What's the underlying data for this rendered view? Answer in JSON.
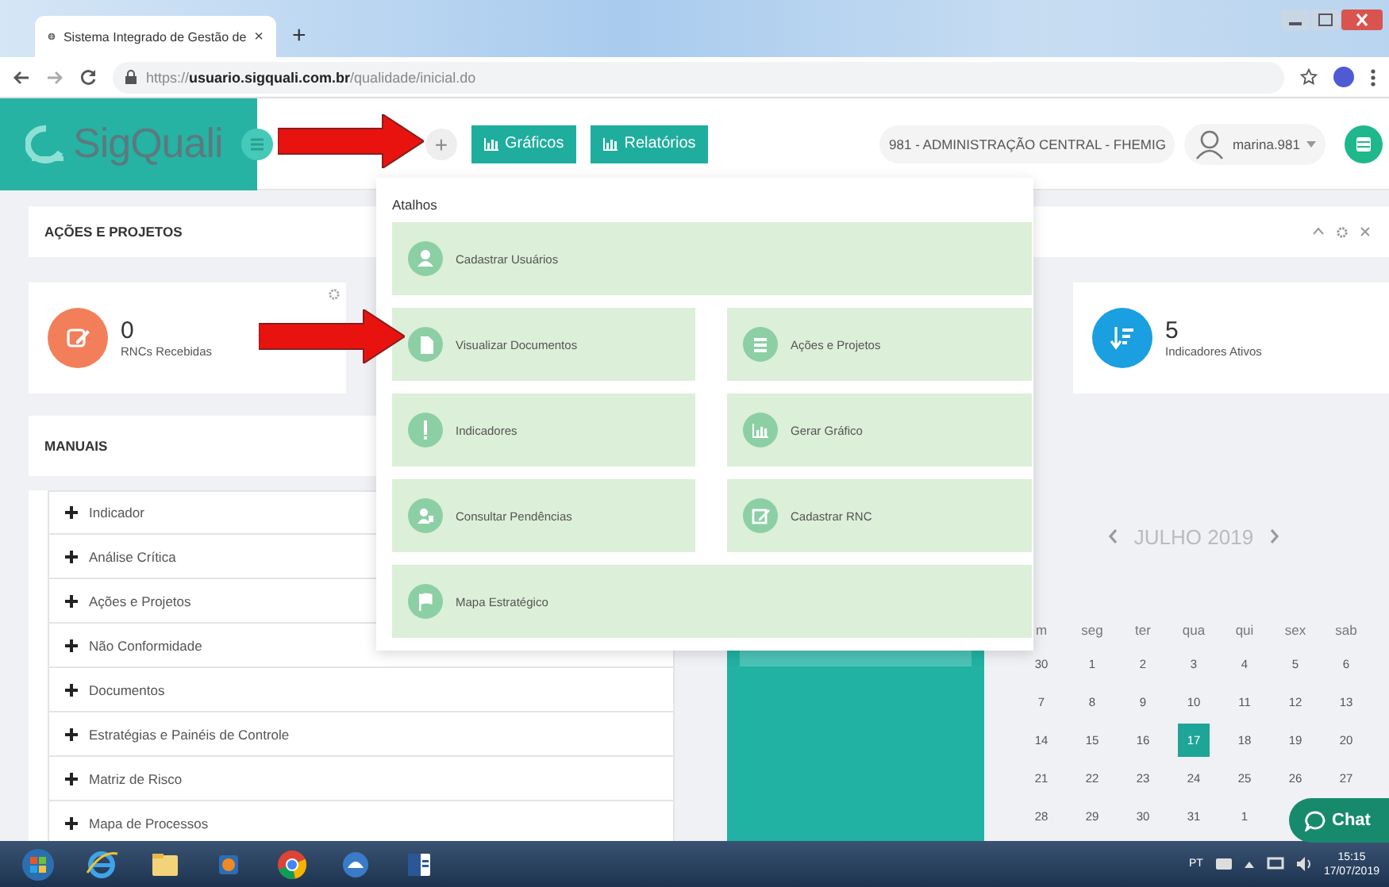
{
  "browser": {
    "tab_title": "Sistema Integrado de Gestão de",
    "tab_close": "×",
    "new_tab": "+",
    "url": "https://**usuario.sigquali.com.br**/qualidade/inicial.do"
  },
  "header": {
    "logo": "SigQuali",
    "add_button": "+",
    "buttons": [
      {
        "label": "Gráficos"
      },
      {
        "label": "Relatórios"
      }
    ],
    "unit": "981 - ADMINISTRAÇÃO CENTRAL - FHEMIG",
    "user": "marina.981"
  },
  "panel": {
    "title": "AÇÕES E PROJETOS"
  },
  "stats": [
    {
      "value": "0",
      "label": "RNCs Recebidas",
      "color": "#f27f5a",
      "kind": "edit"
    },
    {
      "value": "5",
      "label": "Indicadores Ativos",
      "color": "#1a9fe0",
      "kind": "sort"
    }
  ],
  "manuals": {
    "title": "MANUAIS",
    "items": [
      "Indicador",
      "Análise Crítica",
      "Ações e Projetos",
      "Não Conformidade",
      "Documentos",
      "Estratégias e Painéis de Controle",
      "Matriz de Risco",
      "Mapa de Processos"
    ]
  },
  "calendar": {
    "month": "JULHO 2019",
    "weekdays": [
      "m",
      "seg",
      "ter",
      "qua",
      "qui",
      "sex",
      "sab"
    ],
    "weeks": [
      [
        {
          "day": "30",
          "selected": false
        },
        {
          "day": "1",
          "selected": false
        },
        {
          "day": "2",
          "selected": false
        },
        {
          "day": "3",
          "selected": false
        },
        {
          "day": "4",
          "selected": false
        },
        {
          "day": "5",
          "selected": false
        },
        {
          "day": "6",
          "selected": false
        }
      ],
      [
        {
          "day": "7",
          "selected": false
        },
        {
          "day": "8",
          "selected": false
        },
        {
          "day": "9",
          "selected": false
        },
        {
          "day": "10",
          "selected": false
        },
        {
          "day": "11",
          "selected": false
        },
        {
          "day": "12",
          "selected": false
        },
        {
          "day": "13",
          "selected": false
        }
      ],
      [
        {
          "day": "14",
          "selected": false
        },
        {
          "day": "15",
          "selected": false
        },
        {
          "day": "16",
          "selected": false
        },
        {
          "day": "17",
          "selected": true
        },
        {
          "day": "18",
          "selected": false
        },
        {
          "day": "19",
          "selected": false
        },
        {
          "day": "20",
          "selected": false
        }
      ],
      [
        {
          "day": "21",
          "selected": false
        },
        {
          "day": "22",
          "selected": false
        },
        {
          "day": "23",
          "selected": false
        },
        {
          "day": "24",
          "selected": false
        },
        {
          "day": "25",
          "selected": false
        },
        {
          "day": "26",
          "selected": false
        },
        {
          "day": "27",
          "selected": false
        }
      ],
      [
        {
          "day": "28",
          "selected": false
        },
        {
          "day": "29",
          "selected": false
        },
        {
          "day": "30",
          "selected": false
        },
        {
          "day": "31",
          "selected": false
        },
        {
          "day": "1",
          "selected": false
        }
      ]
    ]
  },
  "shortcuts": {
    "title": "Atalhos",
    "items": [
      {
        "label": "Cadastrar Usuários",
        "kind": "user",
        "wide": true
      },
      {
        "label": "Visualizar Documentos",
        "kind": "file",
        "wide": false
      },
      {
        "label": "Ações e Projetos",
        "kind": "list",
        "wide": false
      },
      {
        "label": "Indicadores",
        "kind": "alert",
        "wide": false
      },
      {
        "label": "Gerar Gráfico",
        "kind": "chart",
        "wide": false
      },
      {
        "label": "Consultar Pendências",
        "kind": "person",
        "wide": false
      },
      {
        "label": "Cadastrar RNC",
        "kind": "edit",
        "wide": false
      },
      {
        "label": "Mapa Estratégico",
        "kind": "flag",
        "wide": true
      }
    ]
  },
  "chat": {
    "label": "Chat"
  },
  "taskbar": {
    "language": "PT",
    "time": "15:15",
    "date": "17/07/2019"
  }
}
